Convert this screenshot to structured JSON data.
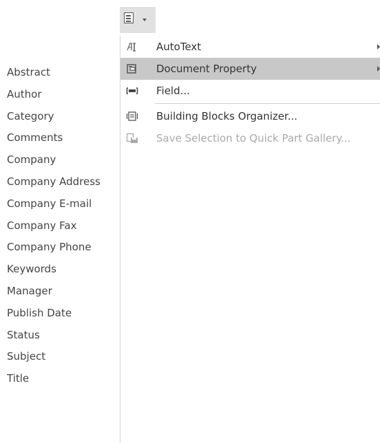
{
  "quick_parts": {
    "icon": "quick-parts-icon",
    "dropdown": "chevron-down-icon"
  },
  "menu": {
    "items": [
      {
        "label": "AutoText",
        "icon": "autotext-icon",
        "has_submenu": true
      },
      {
        "label": "Document Property",
        "icon": "document-property-icon",
        "has_submenu": true
      },
      {
        "label": "Field...",
        "icon": "field-icon",
        "has_submenu": false
      },
      {
        "label": "Building Blocks Organizer...",
        "icon": "building-blocks-icon",
        "has_submenu": false
      },
      {
        "label": "Save Selection to Quick Part Gallery...",
        "icon": "save-to-gallery-icon",
        "has_submenu": false
      }
    ]
  },
  "document_properties": {
    "items": [
      "Abstract",
      "Author",
      "Category",
      "Comments",
      "Company",
      "Company Address",
      "Company E-mail",
      "Company Fax",
      "Company Phone",
      "Keywords",
      "Manager",
      "Publish Date",
      "Status",
      "Subject",
      "Title"
    ]
  },
  "colors": {
    "active_item_bg": "#c8c8c8",
    "disabled_text": "#a9a9a9",
    "button_bg": "#e1e1e1"
  }
}
